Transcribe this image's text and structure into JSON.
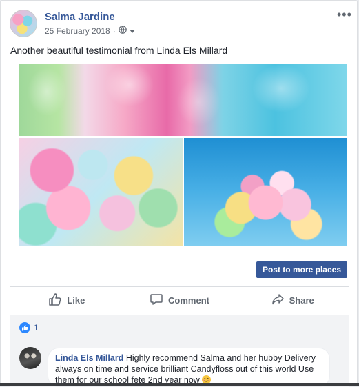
{
  "post": {
    "author": "Salma Jardine",
    "date": "25 February 2018",
    "date_separator": "·",
    "text": "Another beautiful testimonial from Linda Els Millard",
    "more_label": "•••"
  },
  "buttons": {
    "post_to_more": "Post to more places"
  },
  "actions": [
    {
      "label": "Like",
      "icon": "thumbs-up-icon"
    },
    {
      "label": "Comment",
      "icon": "comment-icon"
    },
    {
      "label": "Share",
      "icon": "share-icon"
    }
  ],
  "reactions": {
    "count": "1",
    "icon": "like-reaction-icon",
    "color": "#2d88ff"
  },
  "comment": {
    "author": "Linda Els Millard",
    "text": "Highly recommend Salma and her hubby Delivery always on time and service brilliant Candyfloss out of this world Use them for our school fete 2nd year now"
  },
  "colors": {
    "link": "#365899",
    "button_bg": "#365899",
    "page_bg": "#e9ebee"
  }
}
